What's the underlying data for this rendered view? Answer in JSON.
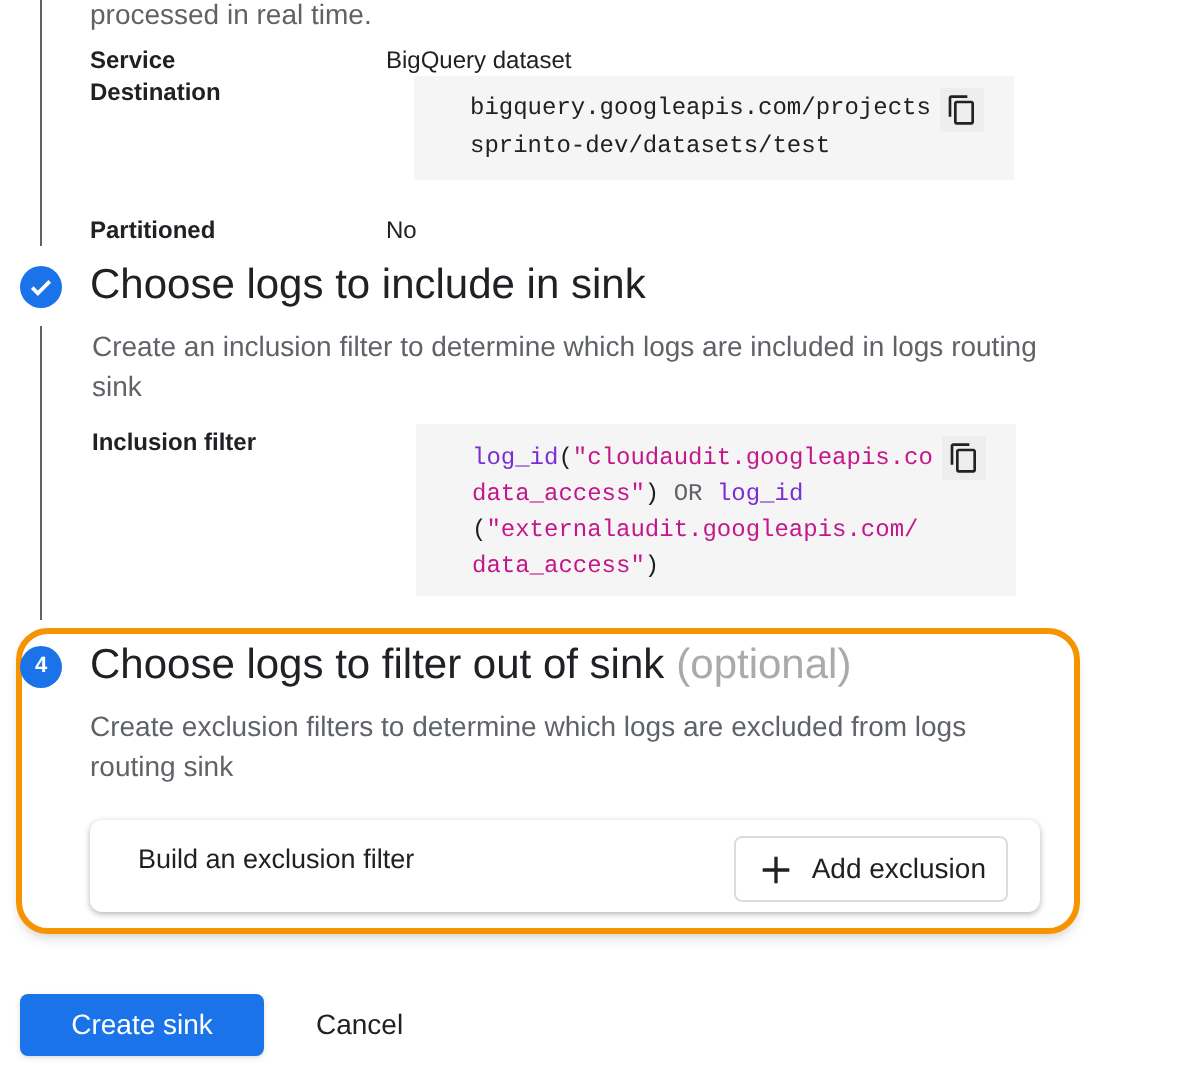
{
  "intro_text": "processed in real time.",
  "destination": {
    "rows": [
      {
        "label": "Service",
        "value": "BigQuery dataset"
      },
      {
        "label": "Destination",
        "code_lines": [
          [
            {
              "kind": "plain",
              "text": "bigquery.googleapis.com/projects"
            }
          ],
          [
            {
              "kind": "plain",
              "text": "sprinto-dev/datasets/test"
            }
          ]
        ]
      },
      {
        "label": "Partitioned",
        "value": "No"
      }
    ]
  },
  "steps": [
    {
      "kind": "done",
      "title": "Choose logs to include in sink",
      "description": "Create an inclusion filter to determine which logs are included in logs routing sink",
      "highlighted": false,
      "filter": {
        "label": "Inclusion filter",
        "code_lines": [
          [
            {
              "kind": "fn",
              "text": "log_id"
            },
            {
              "kind": "plain",
              "text": "("
            },
            {
              "kind": "str",
              "text": "\"cloudaudit.googleapis.co"
            }
          ],
          [
            {
              "kind": "str",
              "text": "data_access\""
            },
            {
              "kind": "plain",
              "text": ") "
            },
            {
              "kind": "op",
              "text": "OR "
            },
            {
              "kind": "fn",
              "text": "log_id"
            }
          ],
          [
            {
              "kind": "plain",
              "text": "("
            },
            {
              "kind": "str",
              "text": "\"externalaudit.googleapis.com/"
            }
          ],
          [
            {
              "kind": "str",
              "text": "data_access\""
            },
            {
              "kind": "plain",
              "text": ")"
            }
          ]
        ]
      }
    },
    {
      "kind": "number",
      "number": "4",
      "title": "Choose logs to filter out of sink",
      "optional": "(optional)",
      "description": "Create exclusion filters to determine which logs are excluded from logs routing sink",
      "highlighted": true,
      "builder": {
        "label": "Build an exclusion filter",
        "button": "Add exclusion"
      }
    }
  ],
  "actions": {
    "primary": "Create sink",
    "secondary": "Cancel"
  }
}
